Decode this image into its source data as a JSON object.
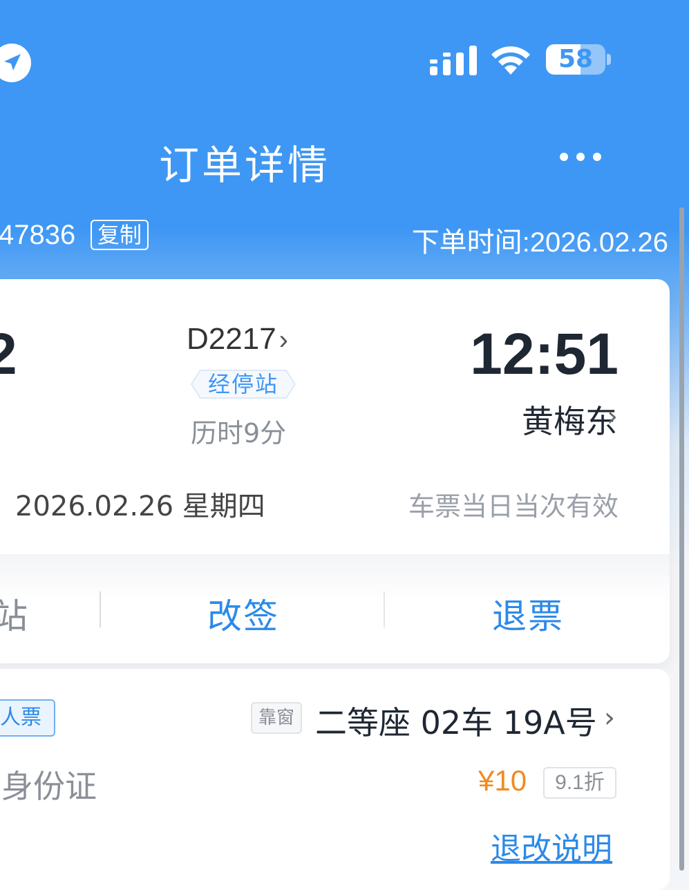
{
  "status_bar": {
    "battery_level": "58",
    "battery_fraction": 0.58,
    "icons": [
      "location-arrow-icon",
      "signal-icon",
      "wifi-icon",
      "battery-icon"
    ]
  },
  "header": {
    "title": "订单详情",
    "more_icon": "ellipsis-icon"
  },
  "order": {
    "number_partial": "47836",
    "copy_label": "复制",
    "order_time": "下单时间:2026.02.26"
  },
  "trip": {
    "departure_time_partial": "2",
    "train_number": "D2217",
    "stops_label": "经停站",
    "duration": "历时9分",
    "arrival_time": "12:51",
    "arrival_station": "黄梅东",
    "travel_date": "2026.02.26 星期四",
    "validity_note": "车票当日当次有效"
  },
  "actions": {
    "stations_partial": "站",
    "change_label": "改签",
    "refund_label": "退票"
  },
  "passenger": {
    "ticket_type_partial": "人票",
    "seat_preference": "靠窗",
    "seat_info": "二等座 02车 19A号",
    "id_type_partial": "身份证",
    "price": "¥10",
    "discount": "9.1折",
    "rules_link": "退改说明"
  },
  "colors": {
    "brand_blue": "#3e97f4",
    "link_blue": "#2c8ae8",
    "price_orange": "#f08a22"
  }
}
